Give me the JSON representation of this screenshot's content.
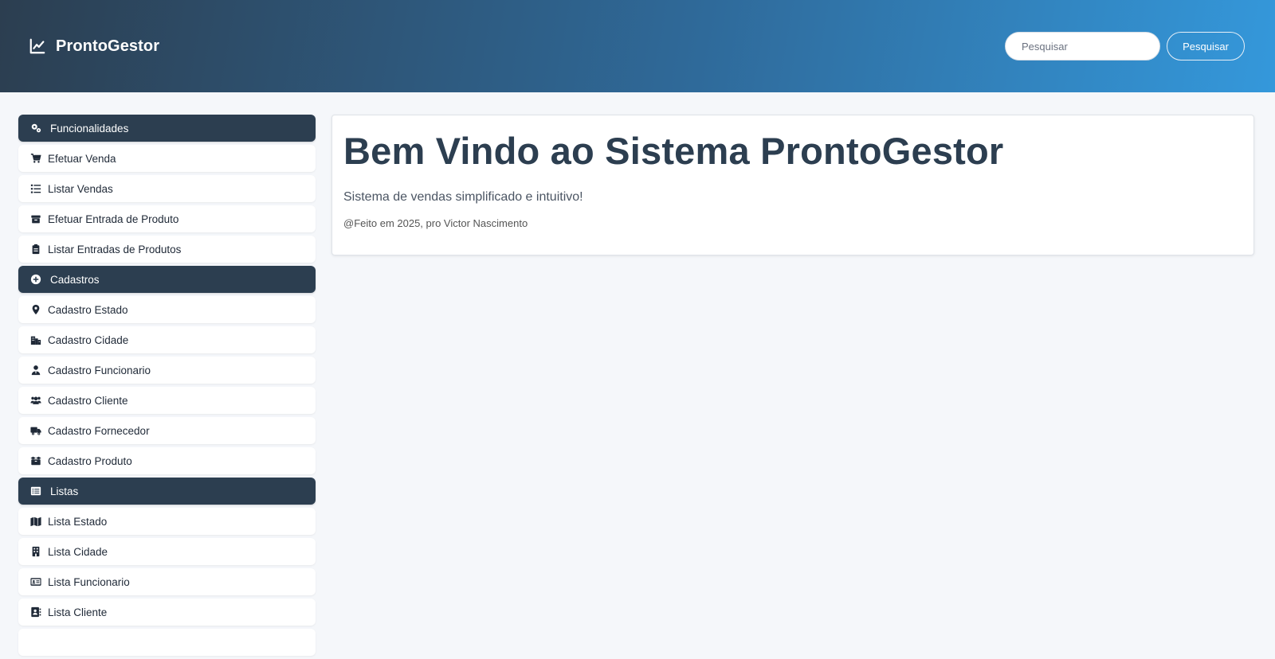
{
  "header": {
    "brand": "ProntoGestor",
    "search_placeholder": "Pesquisar",
    "search_button": "Pesquisar"
  },
  "sidebar": {
    "sections": [
      {
        "title": "Funcionalidades",
        "icon": "gears-icon",
        "items": [
          {
            "label": "Efetuar Venda",
            "icon": "cart-icon"
          },
          {
            "label": "Listar Vendas",
            "icon": "list-icon"
          },
          {
            "label": "Efetuar Entrada de Produto",
            "icon": "box-icon"
          },
          {
            "label": "Listar Entradas de Produtos",
            "icon": "clipboard-icon"
          }
        ]
      },
      {
        "title": "Cadastros",
        "icon": "plus-circle-icon",
        "items": [
          {
            "label": "Cadastro Estado",
            "icon": "map-pin-icon"
          },
          {
            "label": "Cadastro Cidade",
            "icon": "city-icon"
          },
          {
            "label": "Cadastro Funcionario",
            "icon": "user-tie-icon"
          },
          {
            "label": "Cadastro Cliente",
            "icon": "users-icon"
          },
          {
            "label": "Cadastro Fornecedor",
            "icon": "truck-icon"
          },
          {
            "label": "Cadastro Produto",
            "icon": "boxes-icon"
          }
        ]
      },
      {
        "title": "Listas",
        "icon": "list-alt-icon",
        "items": [
          {
            "label": "Lista Estado",
            "icon": "map-icon"
          },
          {
            "label": "Lista Cidade",
            "icon": "building-icon"
          },
          {
            "label": "Lista Funcionario",
            "icon": "id-card-icon"
          },
          {
            "label": "Lista Cliente",
            "icon": "address-book-icon"
          }
        ]
      }
    ]
  },
  "main": {
    "title": "Bem Vindo ao Sistema ProntoGestor",
    "subtitle": "Sistema de vendas simplificado e intuitivo!",
    "credit": "@Feito em 2025, pro Victor Nascimento"
  },
  "colors": {
    "primary_dark": "#2c3e50",
    "accent_blue": "#3498db",
    "background": "#f5f7fa"
  }
}
